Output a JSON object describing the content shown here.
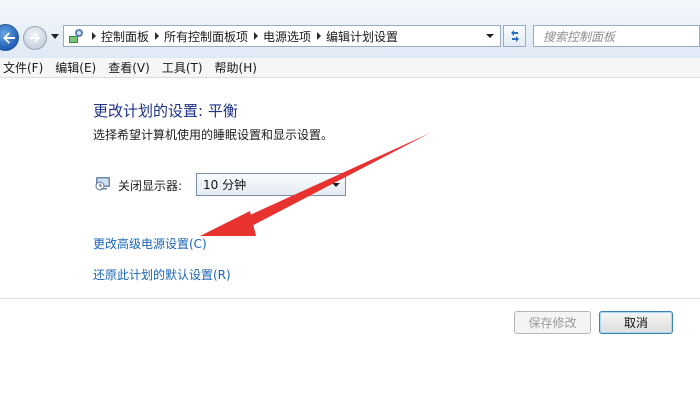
{
  "breadcrumb": {
    "items": [
      "控制面板",
      "所有控制面板项",
      "电源选项",
      "编辑计划设置"
    ]
  },
  "search": {
    "placeholder": "搜索控制面板"
  },
  "menu": {
    "items": [
      "文件(F)",
      "编辑(E)",
      "查看(V)",
      "工具(T)",
      "帮助(H)"
    ]
  },
  "content": {
    "title": "更改计划的设置: 平衡",
    "subtitle": "选择希望计算机使用的睡眠设置和显示设置。",
    "display_off_label": "关闭显示器:",
    "display_off_value": "10 分钟",
    "advanced_link": "更改高级电源设置(C)",
    "restore_link": "还原此计划的默认设置(R)"
  },
  "buttons": {
    "save": "保存修改",
    "cancel": "取消"
  },
  "colors": {
    "title": "#1e3287",
    "link": "#1a65b8",
    "annotation_arrow": "#e8322f"
  },
  "icons": {
    "back": "back-arrow-icon",
    "forward": "forward-arrow-icon",
    "control_panel": "control-panel-icon",
    "refresh": "refresh-icon",
    "display": "display-timer-icon"
  }
}
